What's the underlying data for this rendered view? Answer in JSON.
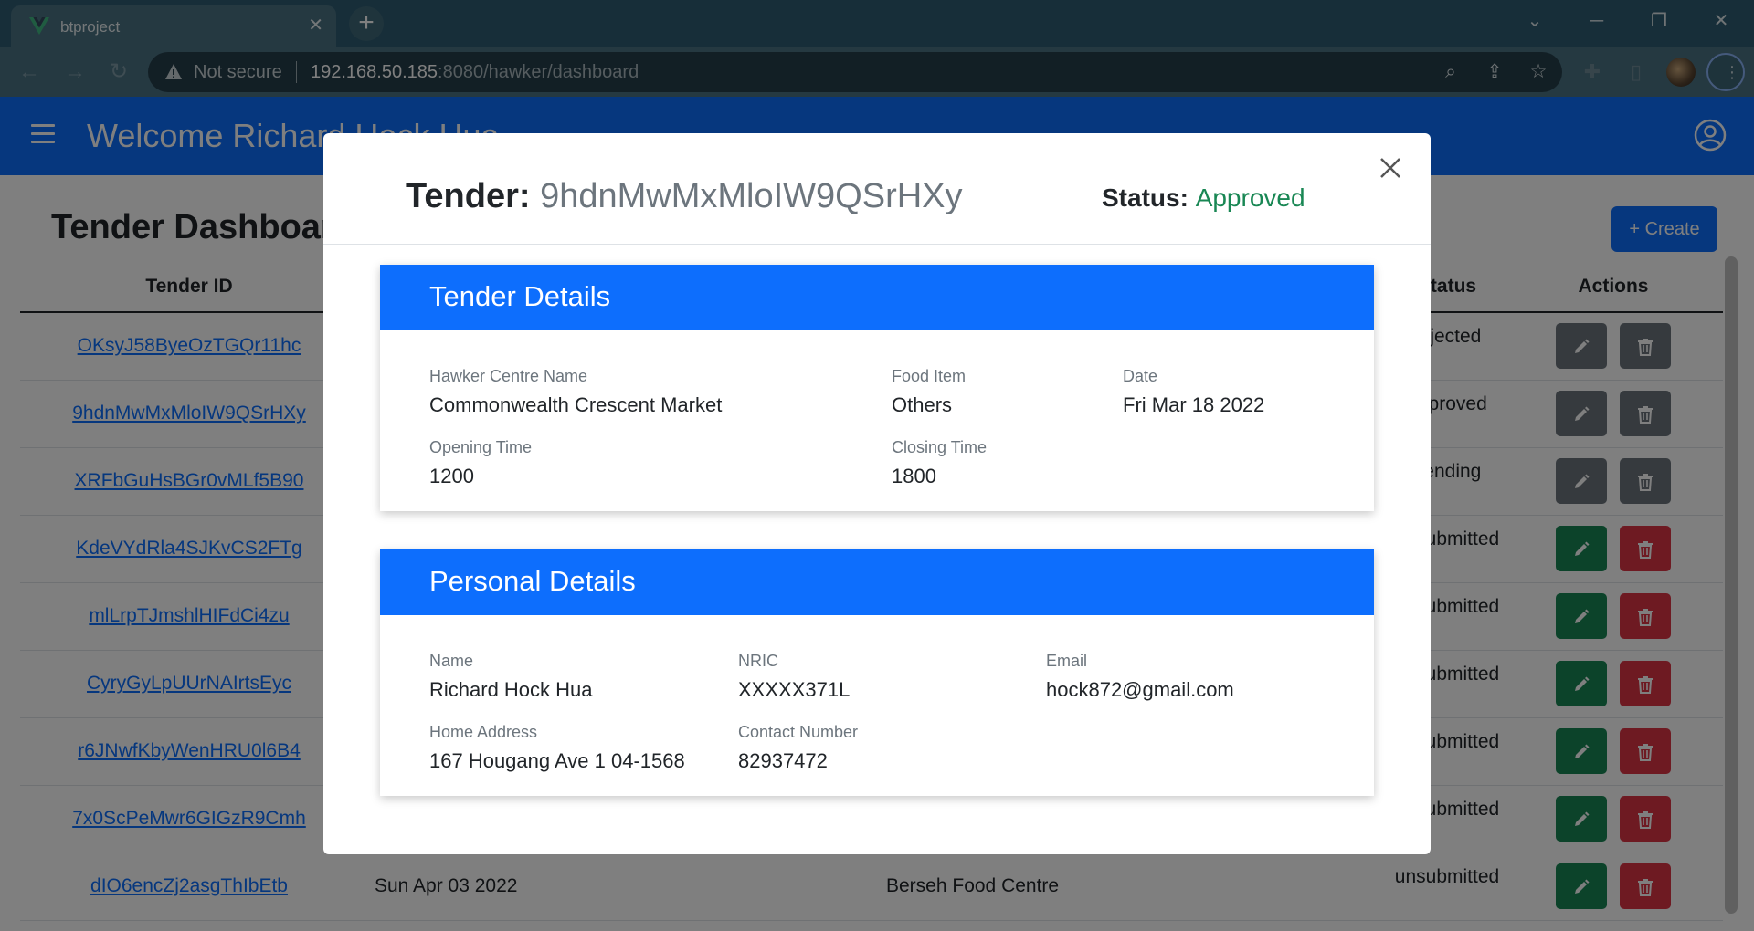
{
  "browser": {
    "tab_title": "btproject",
    "tab_close": "✕",
    "new_tab": "+",
    "not_secure": "Not secure",
    "url_host": "192.168.50.185",
    "url_rest": ":8080/hawker/dashboard"
  },
  "app": {
    "welcome": "Welcome Richard Hock Hua",
    "dashboard_title": "Tender Dashboard",
    "create_button": "+ Create"
  },
  "table": {
    "headers": {
      "tender_id": "Tender ID",
      "status": "Status",
      "actions": "Actions"
    },
    "rows": [
      {
        "id": "OKsyJ58ByeOzTGQr11hc",
        "status": "rejected",
        "date": "",
        "centre": ""
      },
      {
        "id": "9hdnMwMxMloIW9QSrHXy",
        "status": "approved",
        "date": "",
        "centre": ""
      },
      {
        "id": "XRFbGuHsBGr0vMLf5B90",
        "status": "pending",
        "date": "",
        "centre": ""
      },
      {
        "id": "KdeVYdRla4SJKvCS2FTg",
        "status": "unsubmitted",
        "date": "",
        "centre": ""
      },
      {
        "id": "mlLrpTJmshlHIFdCi4zu",
        "status": "unsubmitted",
        "date": "",
        "centre": ""
      },
      {
        "id": "CyryGyLpUUrNAIrtsEyc",
        "status": "unsubmitted",
        "date": "",
        "centre": ""
      },
      {
        "id": "r6JNwfKbyWenHRU0l6B4",
        "status": "unsubmitted",
        "date": "",
        "centre": ""
      },
      {
        "id": "7x0ScPeMwr6GIGzR9Cmh",
        "status": "unsubmitted",
        "date": "",
        "centre": ""
      },
      {
        "id": "dIO6encZj2asgThIbEtb",
        "status": "unsubmitted",
        "date": "Sun Apr 03 2022",
        "centre": "Berseh Food Centre"
      }
    ]
  },
  "modal": {
    "title_label": "Tender:",
    "tender_id": "9hdnMwMxMloIW9QSrHXy",
    "status_label": "Status:",
    "status_value": "Approved",
    "tender_details": {
      "heading": "Tender Details",
      "hawker_centre_label": "Hawker Centre Name",
      "hawker_centre": "Commonwealth Crescent Market",
      "food_item_label": "Food Item",
      "food_item": "Others",
      "date_label": "Date",
      "date": "Fri Mar 18 2022",
      "opening_label": "Opening Time",
      "opening": "1200",
      "closing_label": "Closing Time",
      "closing": "1800"
    },
    "personal_details": {
      "heading": "Personal Details",
      "name_label": "Name",
      "name": "Richard Hock Hua",
      "nric_label": "NRIC",
      "nric": "XXXXX371L",
      "email_label": "Email",
      "email": "hock872@gmail.com",
      "address_label": "Home Address",
      "address": "167 Hougang Ave 1 04-1568",
      "contact_label": "Contact Number",
      "contact": "82937472"
    }
  },
  "colors": {
    "primary": "#0d6efd",
    "success": "#198754",
    "danger": "#dc3545",
    "warning": "#ffc107",
    "secondary": "#6c757d"
  }
}
